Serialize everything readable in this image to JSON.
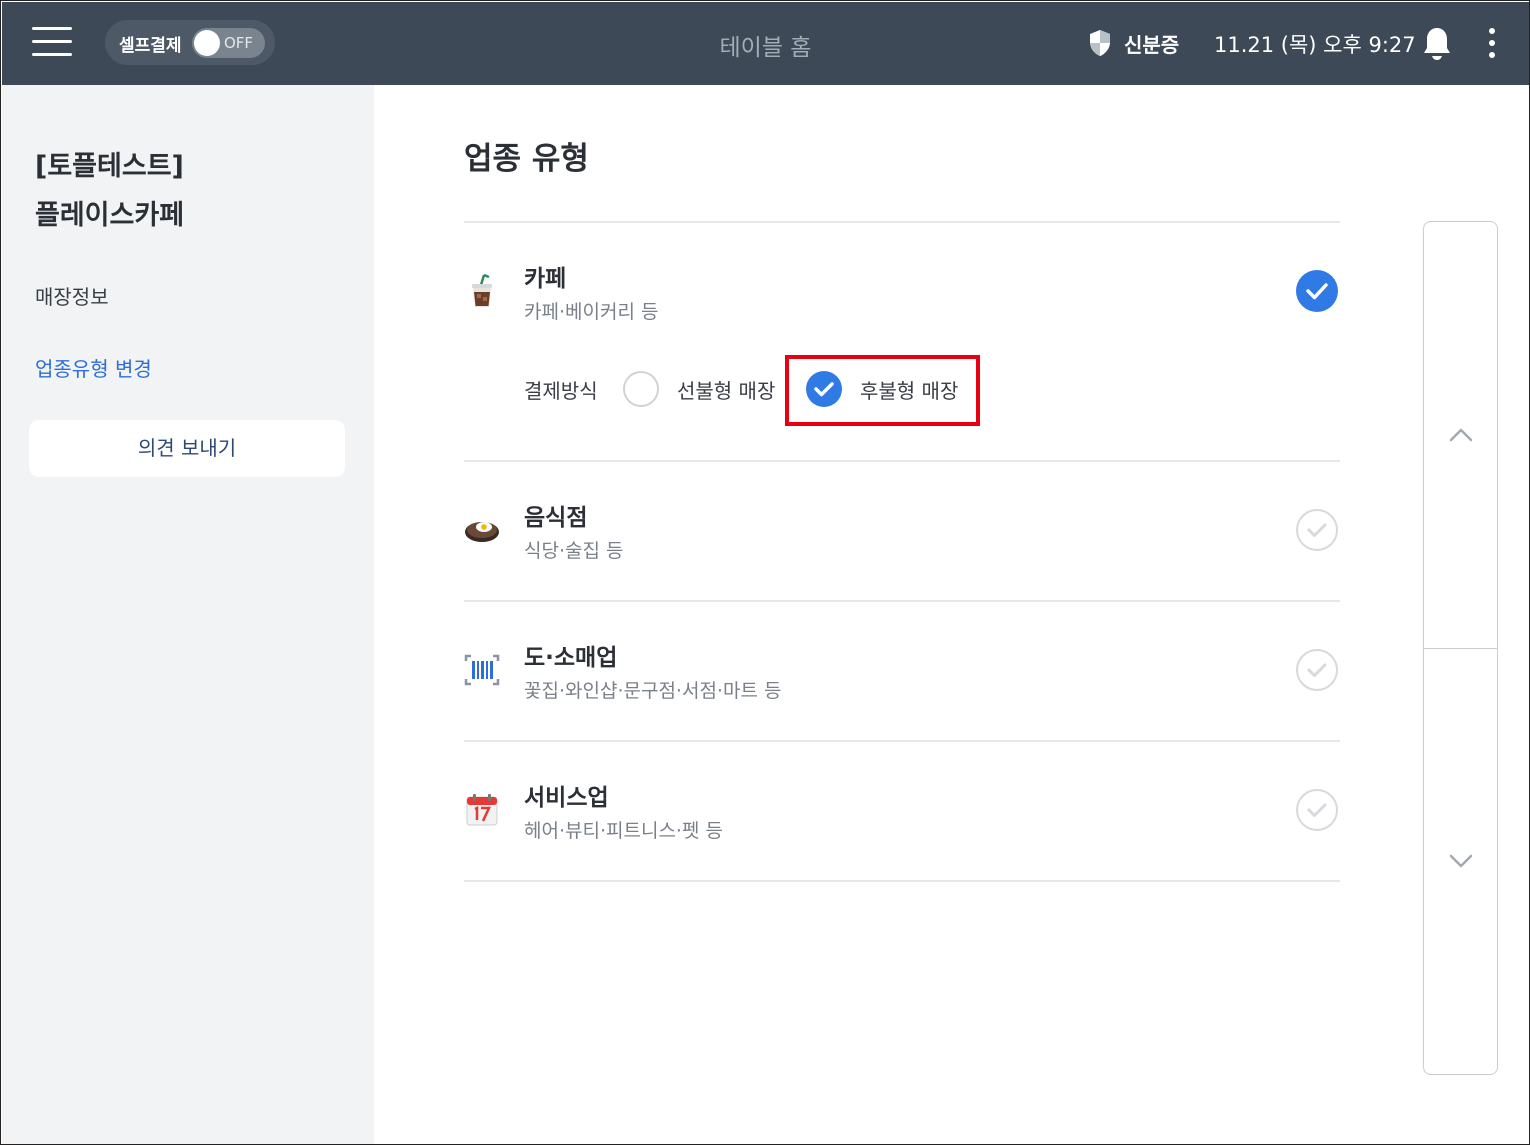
{
  "topbar": {
    "self_pay_label": "셀프결제",
    "self_pay_toggle": "OFF",
    "title": "테이블 홈",
    "id_label": "신분증",
    "datetime": "11.21 (목) 오후 9:27"
  },
  "sidebar": {
    "store_line1": "[토플테스트]",
    "store_line2": "플레이스카페",
    "nav_store_info": "매장정보",
    "nav_business_type": "업종유형 변경",
    "feedback_button": "의견 보내기"
  },
  "main": {
    "title": "업종 유형",
    "types": [
      {
        "title": "카페",
        "subtitle": "카페·베이커리 등",
        "icon": "iced-coffee-icon",
        "selected": true
      },
      {
        "title": "음식점",
        "subtitle": "식당·술집 등",
        "icon": "food-plate-icon",
        "selected": false
      },
      {
        "title": "도·소매업",
        "subtitle": "꽃집·와인샵·문구점·서점·마트 등",
        "icon": "barcode-icon",
        "selected": false
      },
      {
        "title": "서비스업",
        "subtitle": "헤어·뷰티·피트니스·펫 등",
        "icon": "calendar-icon",
        "selected": false
      }
    ],
    "payment": {
      "label": "결제방식",
      "prepay": "선불형 매장",
      "postpay": "후불형 매장",
      "selected": "postpay"
    }
  },
  "colors": {
    "topbar_bg": "#3d4956",
    "accent": "#2f7ae5",
    "highlight": "#e60012",
    "sidebar_bg": "#f2f3f5"
  }
}
